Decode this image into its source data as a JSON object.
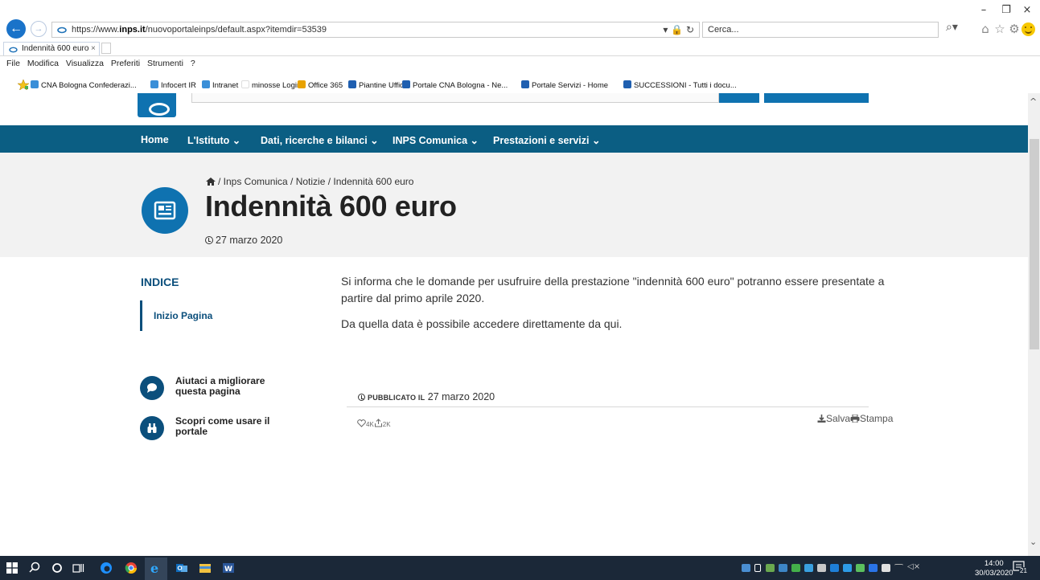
{
  "browser": {
    "url_prefix": "https://www.",
    "url_domain": "inps.it",
    "url_path": "/nuovoportaleinps/default.aspx?itemdir=53539",
    "search_placeholder": "Cerca...",
    "tab_title": "Indennità 600 euro",
    "tab_close": "×",
    "window_min": "–",
    "window_max": "❐",
    "window_close": "×",
    "menu": [
      "File",
      "Modifica",
      "Visualizza",
      "Preferiti",
      "Strumenti",
      "?"
    ],
    "favorites": [
      {
        "label": "CNA Bologna  Confederazi...",
        "color": "#3a8fd8"
      },
      {
        "label": "Infocert IR",
        "color": "#3a8fd8"
      },
      {
        "label": "Intranet",
        "color": "#3a8fd8"
      },
      {
        "label": "minosse Login",
        "color": "#ffffff"
      },
      {
        "label": "Office 365",
        "color": "#e8a200"
      },
      {
        "label": "Piantine Uffici",
        "color": "#1f5fb0"
      },
      {
        "label": "Portale CNA Bologna - Ne...",
        "color": "#1f5fb0"
      },
      {
        "label": "Portale Servizi - Home",
        "color": "#1f5fb0"
      },
      {
        "label": "SUCCESSIONI - Tutti i docu...",
        "color": "#1f5fb0"
      }
    ]
  },
  "nav": {
    "items": [
      "Home",
      "L'Istituto ⌄",
      "Dati, ricerche e bilanci ⌄",
      "INPS Comunica ⌄",
      "Prestazioni e servizi ⌄"
    ]
  },
  "hero": {
    "breadcrumb": "/ Inps Comunica / Notizie / Indennità 600 euro",
    "title": "Indennità 600 euro",
    "date": "27 marzo 2020"
  },
  "sidebar": {
    "indice_title": "INDICE",
    "indice_item": "Inizio Pagina",
    "help1_line1": "Aiutaci a migliorare",
    "help1_line2": "questa pagina",
    "help2_line1": "Scopri come usare il",
    "help2_line2": "portale"
  },
  "content": {
    "paragraph1": "Si informa che le domande per usufruire della prestazione \"indennità 600 euro\" potranno essere presentate a partire dal primo aprile 2020.",
    "paragraph2": "Da quella data è possibile accedere direttamente da qui."
  },
  "footer_meta": {
    "published_label": "PUBBLICATO IL",
    "published_date": "27 marzo 2020",
    "likes": "4K",
    "shares": "2K",
    "save_label": "Salva",
    "print_label": "Stampa"
  },
  "taskbar": {
    "time": "14:00",
    "date": "30/03/2020",
    "notifications": "21"
  },
  "colors": {
    "nav_bg": "#0b5e83",
    "accent": "#0f72b0",
    "hero_bg": "#f2f2f2",
    "taskbar_bg": "#1b2838"
  }
}
